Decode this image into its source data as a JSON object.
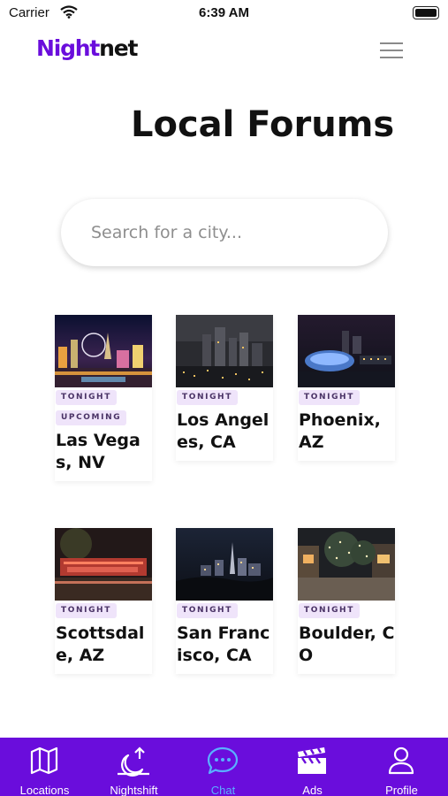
{
  "status_bar": {
    "carrier": "Carrier",
    "time": "6:39 AM"
  },
  "header": {
    "logo_part1": "Night",
    "logo_part2": "net",
    "menu_icon": "hamburger-menu-icon"
  },
  "page": {
    "title": "Local Forums"
  },
  "search": {
    "placeholder": "Search for a city..."
  },
  "forums": [
    {
      "city": "Las Vegas, NV",
      "badges": [
        "TONIGHT",
        "UPCOMING"
      ]
    },
    {
      "city": "Los Angeles, CA",
      "badges": [
        "TONIGHT"
      ]
    },
    {
      "city": "Phoenix, AZ",
      "badges": [
        "TONIGHT"
      ]
    },
    {
      "city": "Scottsdale, AZ",
      "badges": [
        "TONIGHT"
      ]
    },
    {
      "city": "San Francisco, CA",
      "badges": [
        "TONIGHT"
      ]
    },
    {
      "city": "Boulder, CO",
      "badges": [
        "TONIGHT"
      ]
    }
  ],
  "tabs": [
    {
      "label": "Locations",
      "icon": "map-icon"
    },
    {
      "label": "Nightshift",
      "icon": "moon-upload-icon"
    },
    {
      "label": "Chat",
      "icon": "chat-bubble-icon",
      "active": true
    },
    {
      "label": "Ads",
      "icon": "clapperboard-icon"
    },
    {
      "label": "Profile",
      "icon": "person-icon"
    }
  ],
  "colors": {
    "brand": "#6A0DDC",
    "active_tab": "#5AB0FF",
    "badge_bg": "#EFE4FA"
  }
}
